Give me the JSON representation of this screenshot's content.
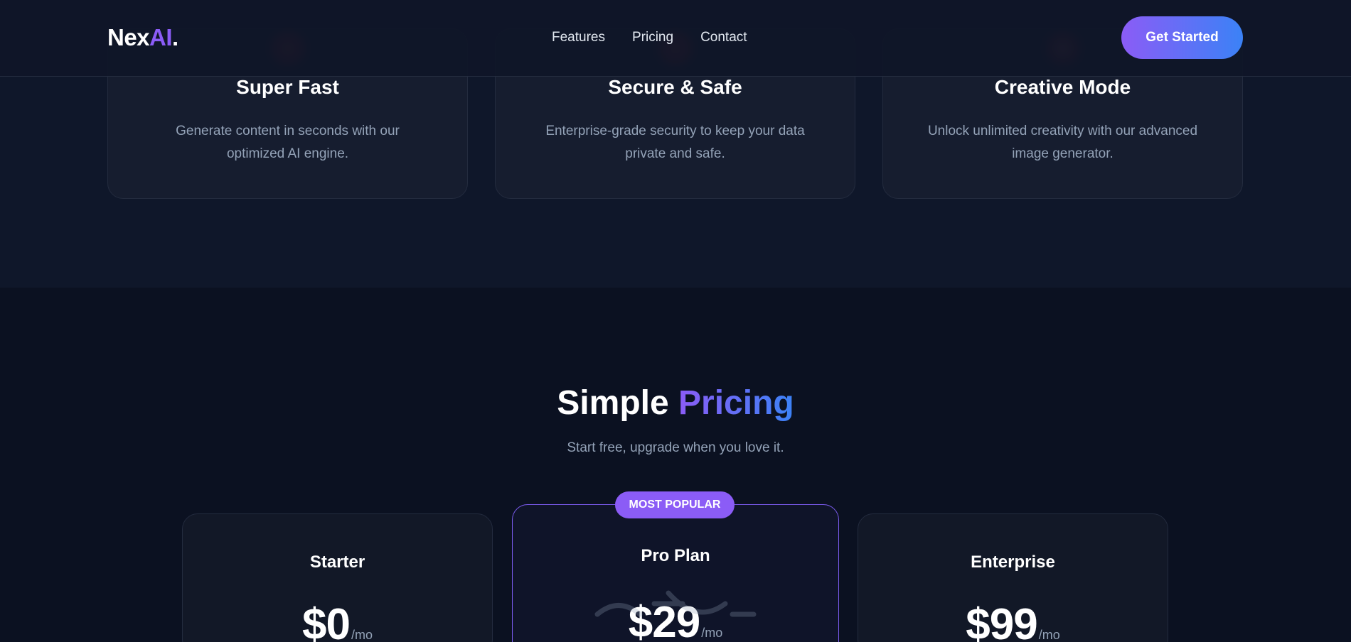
{
  "nav": {
    "logo_main": "Nex",
    "logo_accent": "AI",
    "logo_dot": ".",
    "links": [
      "Features",
      "Pricing",
      "Contact"
    ],
    "cta_label": "Get Started"
  },
  "features": [
    {
      "title": "Super Fast",
      "description": "Generate content in seconds with our optimized AI engine.",
      "icon": "lightning-icon",
      "icon_color": "#ef4444"
    },
    {
      "title": "Secure & Safe",
      "description": "Enterprise-grade security to keep your data private and safe.",
      "icon": "lock-icon",
      "icon_color": "#ef4444"
    },
    {
      "title": "Creative Mode",
      "description": "Unlock unlimited creativity with our advanced image generator.",
      "icon": "palette-icon",
      "icon_color": "#f87171"
    }
  ],
  "pricing": {
    "title_main": "Simple",
    "title_accent": "Pricing",
    "subtitle": "Start free, upgrade when you love it.",
    "badge": "MOST POPULAR",
    "plans": [
      {
        "name": "Starter",
        "price": "$0",
        "period": "/mo"
      },
      {
        "name": "Pro Plan",
        "price": "$29",
        "period": "/mo"
      },
      {
        "name": "Enterprise",
        "price": "$99",
        "period": "/mo"
      }
    ]
  },
  "colors": {
    "accent_purple": "#8b5cf6",
    "accent_blue": "#3b82f6",
    "background": "#0b1121",
    "muted_text": "#94a3b8"
  }
}
